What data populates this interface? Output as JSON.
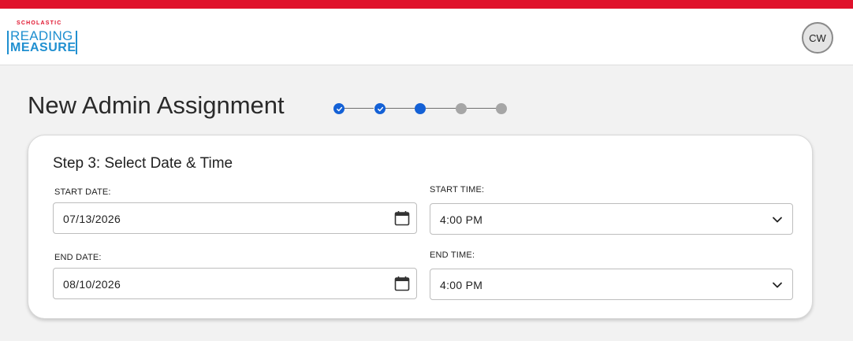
{
  "header": {
    "logo": {
      "brand": "SCHOLASTIC",
      "line1": "READING",
      "line2": "MEASURE"
    },
    "avatar_initials": "CW",
    "accent_color": "#e0112b",
    "logo_color": "#1f8fd0"
  },
  "main": {
    "title": "New Admin Assignment",
    "stepper": {
      "total_steps": 5,
      "current_step": 3,
      "steps": [
        {
          "status": "done",
          "icon": "check-icon"
        },
        {
          "status": "done",
          "icon": "check-icon"
        },
        {
          "status": "current"
        },
        {
          "status": "todo"
        },
        {
          "status": "todo"
        }
      ],
      "active_color": "#1461d6",
      "inactive_color": "#a6a6a6"
    },
    "card": {
      "title": "Step 3: Select Date & Time",
      "start_date": {
        "label": "START DATE:",
        "value": "07/13/2026",
        "icon": "calendar-icon"
      },
      "start_time": {
        "label": "START TIME:",
        "value": "4:00 PM",
        "icon": "chevron-down-icon"
      },
      "end_date": {
        "label": "END DATE:",
        "value": "08/10/2026",
        "icon": "calendar-icon"
      },
      "end_time": {
        "label": "END TIME:",
        "value": "4:00 PM",
        "icon": "chevron-down-icon"
      }
    }
  }
}
